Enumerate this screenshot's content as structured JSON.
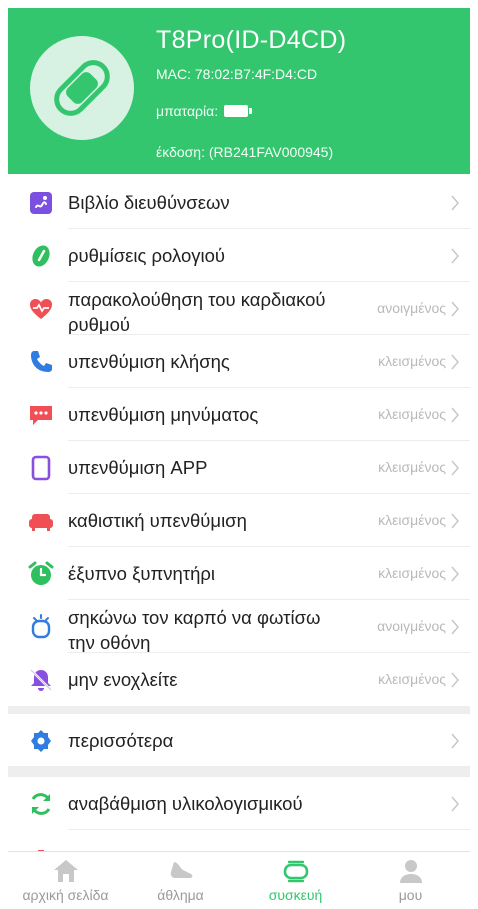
{
  "device": {
    "name": "T8Pro(ID-D4CD)",
    "mac": "MAC: 78:02:B7:4F:D4:CD",
    "battery_label": "μπαταρία:",
    "version": "έκδοση: (RB241FAV000945)"
  },
  "menu": [
    {
      "label": "Βιβλίο διευθύνσεων",
      "status": "",
      "icon": "address-book-icon",
      "color": "#7b4fe0"
    },
    {
      "label": "ρυθμίσεις ρολογιού",
      "status": "",
      "icon": "watch-face-icon",
      "color": "#2fbf5f"
    },
    {
      "label": "παρακολούθηση του καρδιακού ρυθμού",
      "status": "ανοιγμένος",
      "icon": "heart-rate-icon",
      "color": "#ef4f55"
    },
    {
      "label": "υπενθύμιση κλήσης",
      "status": "κλεισμένος",
      "icon": "phone-icon",
      "color": "#2f7de1"
    },
    {
      "label": "υπενθύμιση μηνύματος",
      "status": "κλεισμένος",
      "icon": "message-icon",
      "color": "#ef4f55"
    },
    {
      "label": "υπενθύμιση APP",
      "status": "κλεισμένος",
      "icon": "app-icon",
      "color": "#8a4fe0"
    },
    {
      "label": "καθιστική υπενθύμιση",
      "status": "κλεισμένος",
      "icon": "sofa-icon",
      "color": "#ef4f55"
    },
    {
      "label": "έξυπνο ξυπνητήρι",
      "status": "κλεισμένος",
      "icon": "alarm-clock-icon",
      "color": "#2fbf5f"
    },
    {
      "label": "σηκώνω τον καρπό να φωτίσω την οθόνη",
      "status": "ανοιγμένος",
      "icon": "raise-wrist-icon",
      "color": "#2f7de1"
    },
    {
      "label": "μην ενοχλείτε",
      "status": "κλεισμένος",
      "icon": "bell-off-icon",
      "color": "#8a4fe0"
    }
  ],
  "more": {
    "label": "περισσότερα",
    "icon": "gear-icon",
    "color": "#2f7de1"
  },
  "firmware": {
    "label": "αναβάθμιση υλικολογισμικού",
    "icon": "refresh-icon",
    "color": "#2fbf5f"
  },
  "tabs": [
    {
      "label": "αρχική σελίδα",
      "icon": "home-icon"
    },
    {
      "label": "άθλημα",
      "icon": "sport-icon"
    },
    {
      "label": "συσκευή",
      "icon": "device-icon",
      "active": true
    },
    {
      "label": "μου",
      "icon": "profile-icon"
    }
  ],
  "colors": {
    "accent": "#33c66e",
    "status": "#b9b9b9",
    "divider": "#ededed"
  }
}
